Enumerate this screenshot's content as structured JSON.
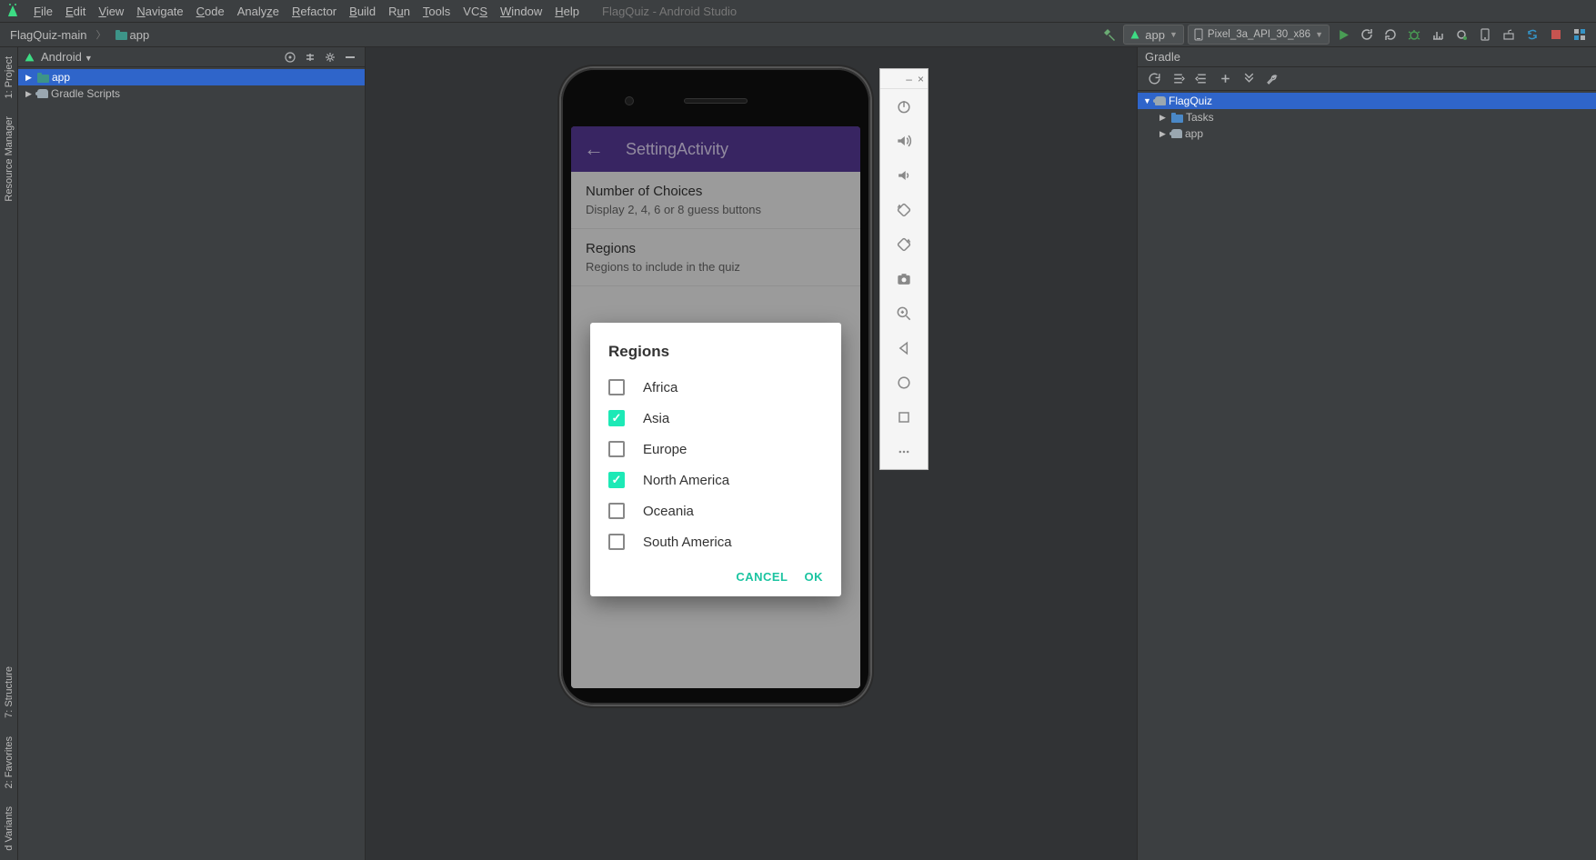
{
  "menubar": {
    "items": [
      "File",
      "Edit",
      "View",
      "Navigate",
      "Code",
      "Analyze",
      "Refactor",
      "Build",
      "Run",
      "Tools",
      "VCS",
      "Window",
      "Help"
    ],
    "title": "FlagQuiz - Android Studio"
  },
  "breadcrumb": {
    "root": "FlagQuiz-main",
    "child": "app"
  },
  "navbar": {
    "run_config": "app",
    "device": "Pixel_3a_API_30_x86"
  },
  "project_panel": {
    "header": "Android",
    "tree": {
      "app": "app",
      "gradle_scripts": "Gradle Scripts"
    }
  },
  "gradle_panel": {
    "header": "Gradle",
    "tree": {
      "root": "FlagQuiz",
      "tasks": "Tasks",
      "app": "app"
    }
  },
  "left_tabs": {
    "project": "1: Project",
    "resource": "Resource Manager",
    "structure": "7: Structure",
    "favorites": "2: Favorites",
    "variants": "d Variants"
  },
  "phone": {
    "appbar_title": "SettingActivity",
    "pref1_title": "Number of Choices",
    "pref1_sub": "Display 2, 4, 6 or 8 guess buttons",
    "pref2_title": "Regions",
    "pref2_sub": "Regions to include in the quiz"
  },
  "dialog": {
    "title": "Regions",
    "items": [
      {
        "label": "Africa",
        "checked": false
      },
      {
        "label": "Asia",
        "checked": true
      },
      {
        "label": "Europe",
        "checked": false
      },
      {
        "label": "North America",
        "checked": true
      },
      {
        "label": "Oceania",
        "checked": false
      },
      {
        "label": "South America",
        "checked": false
      }
    ],
    "cancel": "CANCEL",
    "ok": "OK"
  },
  "emu_titlebar": {
    "min": "–",
    "close": "×"
  }
}
